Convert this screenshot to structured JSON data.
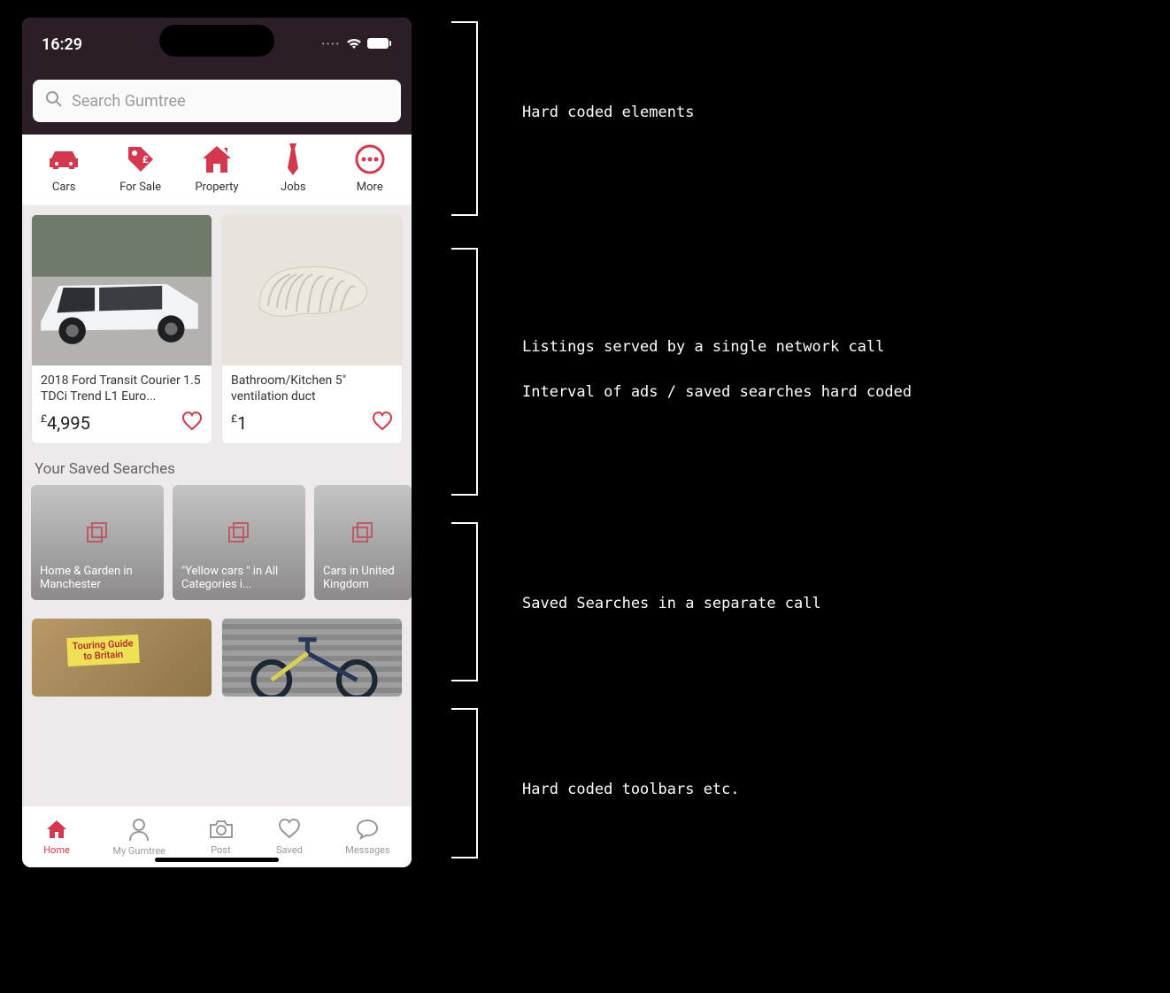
{
  "status": {
    "time": "16:29"
  },
  "search": {
    "placeholder": "Search Gumtree"
  },
  "categories": [
    {
      "id": "cars",
      "label": "Cars",
      "icon": "car-icon"
    },
    {
      "id": "forsale",
      "label": "For Sale",
      "icon": "tag-icon"
    },
    {
      "id": "property",
      "label": "Property",
      "icon": "house-icon"
    },
    {
      "id": "jobs",
      "label": "Jobs",
      "icon": "tie-icon"
    },
    {
      "id": "more",
      "label": "More",
      "icon": "more-icon"
    }
  ],
  "listings": [
    {
      "title": "2018 Ford Transit Courier 1.5 TDCi Trend L1 Euro...",
      "currency": "£",
      "price": "4,995"
    },
    {
      "title": "Bathroom/Kitchen 5\" ventilation duct",
      "currency": "£",
      "price": "1"
    }
  ],
  "saved_searches": {
    "header": "Your Saved Searches",
    "items": [
      {
        "label": "Home & Garden in Manchester"
      },
      {
        "label": "\"Yellow cars \" in All Categories i..."
      },
      {
        "label": "Cars in United Kingdom"
      }
    ]
  },
  "peek_listing": {
    "book_title_line1": "Touring Guide",
    "book_title_line2": "to Britain"
  },
  "bottom_bar": [
    {
      "id": "home",
      "label": "Home",
      "icon": "home-icon",
      "active": true
    },
    {
      "id": "mygumtree",
      "label": "My Gumtree",
      "icon": "person-icon",
      "active": false
    },
    {
      "id": "post",
      "label": "Post",
      "icon": "camera-icon",
      "active": false
    },
    {
      "id": "saved",
      "label": "Saved",
      "icon": "heart-icon",
      "active": false
    },
    {
      "id": "messages",
      "label": "Messages",
      "icon": "chat-icon",
      "active": false
    }
  ],
  "annotations": [
    {
      "text": "Hard coded elements"
    },
    {
      "text": "Listings served by a single network call\n\nInterval of ads / saved searches hard coded"
    },
    {
      "text": "Saved Searches in a separate call"
    },
    {
      "text": "Hard coded toolbars etc."
    }
  ],
  "colors": {
    "accent": "#d4384e",
    "header_bg": "#2b1e27"
  }
}
